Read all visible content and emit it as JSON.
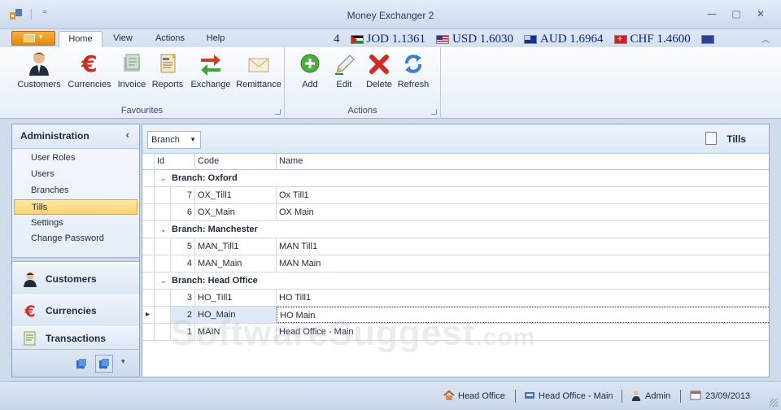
{
  "window": {
    "title": "Money Exchanger 2",
    "quick_access_glyph": "=",
    "min_glyph": "—",
    "restore_glyph": "▢",
    "close_glyph": "✕"
  },
  "tabs": [
    {
      "label": "Home",
      "active": true
    },
    {
      "label": "View",
      "active": false
    },
    {
      "label": "Actions",
      "active": false
    },
    {
      "label": "Help",
      "active": false
    }
  ],
  "rates": {
    "lead": "4",
    "items": [
      {
        "code": "JOD",
        "value": "1.1361",
        "text": "JOD 1.1361",
        "flag": "jordan-flag"
      },
      {
        "code": "USD",
        "value": "1.6030",
        "text": "USD 1.6030",
        "flag": "usa-flag"
      },
      {
        "code": "AUD",
        "value": "1.6964",
        "text": "AUD 1.6964",
        "flag": "australia-flag"
      },
      {
        "code": "CHF",
        "value": "1.4600",
        "text": "CHF 1.4600",
        "flag": "switzerland-flag"
      }
    ]
  },
  "ribbon": {
    "favourites": {
      "label": "Favourites",
      "buttons": [
        {
          "label": "Customers",
          "icon": "customer-icon"
        },
        {
          "label": "Currencies",
          "icon": "euro-icon"
        },
        {
          "label": "Invoice",
          "icon": "invoice-icon"
        },
        {
          "label": "Reports",
          "icon": "report-icon"
        },
        {
          "label": "Exchange",
          "icon": "exchange-icon"
        },
        {
          "label": "Remittance",
          "icon": "envelope-icon"
        }
      ]
    },
    "actions": {
      "label": "Actions",
      "buttons": [
        {
          "label": "Add",
          "icon": "add-icon"
        },
        {
          "label": "Edit",
          "icon": "pencil-icon"
        },
        {
          "label": "Delete",
          "icon": "delete-icon"
        },
        {
          "label": "Refresh",
          "icon": "refresh-icon"
        }
      ]
    }
  },
  "nav": {
    "title": "Administration",
    "collapse_glyph": "‹",
    "items": [
      {
        "label": "User Roles",
        "selected": false
      },
      {
        "label": "Users",
        "selected": false
      },
      {
        "label": "Branches",
        "selected": false
      },
      {
        "label": "Tills",
        "selected": true
      },
      {
        "label": "Settings",
        "selected": false
      },
      {
        "label": "Change Password",
        "selected": false
      }
    ],
    "groups": [
      {
        "label": "Customers",
        "icon": "customer-icon"
      },
      {
        "label": "Currencies",
        "icon": "euro-icon"
      },
      {
        "label": "Transactions",
        "icon": "transactions-icon"
      }
    ]
  },
  "grid": {
    "group_by": "Branch",
    "panel_title": "Tills",
    "columns": [
      "Id",
      "Code",
      "Name"
    ],
    "groups": [
      {
        "label": "Branch: Oxford",
        "rows": [
          {
            "id": "7",
            "code": "OX_Till1",
            "name": "Ox Till1"
          },
          {
            "id": "6",
            "code": "OX_Main",
            "name": "OX Main"
          }
        ]
      },
      {
        "label": "Branch: Manchester",
        "rows": [
          {
            "id": "5",
            "code": "MAN_Till1",
            "name": "MAN Till1"
          },
          {
            "id": "4",
            "code": "MAN_Main",
            "name": "MAN Main"
          }
        ]
      },
      {
        "label": "Branch: Head Office",
        "rows": [
          {
            "id": "3",
            "code": "HO_Till1",
            "name": "HO Till1"
          },
          {
            "id": "2",
            "code": "HO_Main",
            "name": "HO Main",
            "focused": true
          },
          {
            "id": "1",
            "code": "MAIN",
            "name": "Head Office - Main"
          }
        ]
      }
    ]
  },
  "status": {
    "branch": "Head Office",
    "till": "Head Office - Main",
    "user": "Admin",
    "date": "23/09/2013"
  },
  "watermark": {
    "main": "SoftwareSuggest",
    "suffix": ".com"
  },
  "colors": {
    "accent": "#f2a12a",
    "selection": "#fbd46a",
    "rate_text": "#0a1e8a"
  }
}
